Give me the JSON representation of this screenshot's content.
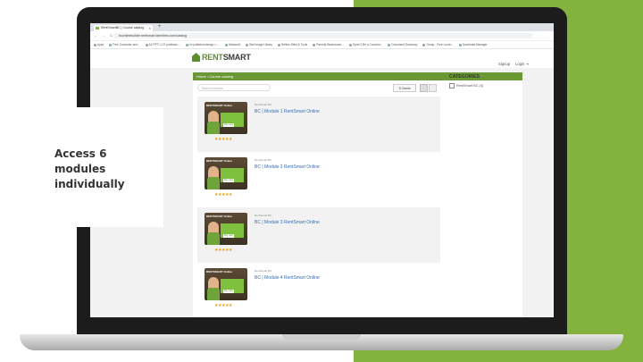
{
  "browser": {
    "tab_title": "RentSmartBC | Course catalog",
    "new_tab": "+",
    "nav_controls": "← → C",
    "url": "bconlinebuilder.rentsmart.talentlms.com/catalog",
    "bookmarks": [
      "Apps",
      "Free Converter and...",
      "AZ PPT LCG professio...",
      "rrc.publisher/design > ...",
      "AdvisorAI",
      "Bali Image Library",
      "Helium Sites & Tools",
      "Parents Warehouse...",
      "Sport 2 Be a Cornerst...",
      "Document Summary",
      "Group - Free Lunch...",
      "Download Manager"
    ]
  },
  "site": {
    "logo_prefix": "RENT",
    "logo_suffix": "SMART",
    "signup": "Signup",
    "login": "Login ⇥",
    "breadcrumb": "Home › Course catalog",
    "search_placeholder": "Search courses",
    "sort_label": "Name"
  },
  "courses": [
    {
      "vendor": "RentSmart BC",
      "title": "BC | Module 1 RentSmart Online",
      "thumb_label": "RENTSMART Online",
      "thumb_button": "Buy now",
      "stars": "★★★★★"
    },
    {
      "vendor": "RentSmart BC",
      "title": "BC | Module 2 RentSmart Online",
      "thumb_label": "RENTSMART Online",
      "thumb_button": "Buy now",
      "stars": "★★★★★"
    },
    {
      "vendor": "RentSmart BC",
      "title": "BC | Module 3 RentSmart Online",
      "thumb_label": "RENTSMART Online",
      "thumb_button": "Buy now",
      "stars": "★★★★★"
    },
    {
      "vendor": "RentSmart BC",
      "title": "BC | Module 4 RentSmart Online",
      "thumb_label": "RENTSMART Online",
      "thumb_button": "Buy now",
      "stars": "★★★★★"
    }
  ],
  "categories": {
    "heading": "CATEGORIES",
    "items": [
      "RentSmart BC (4)"
    ]
  },
  "callout": {
    "line1": "Access 6",
    "line2": "modules",
    "line3": "individually"
  },
  "colors": {
    "accent_green": "#84b23e",
    "breadcrumb_green": "#6a9834",
    "link_blue": "#2f6eb5",
    "star_orange": "#e8a11a"
  }
}
